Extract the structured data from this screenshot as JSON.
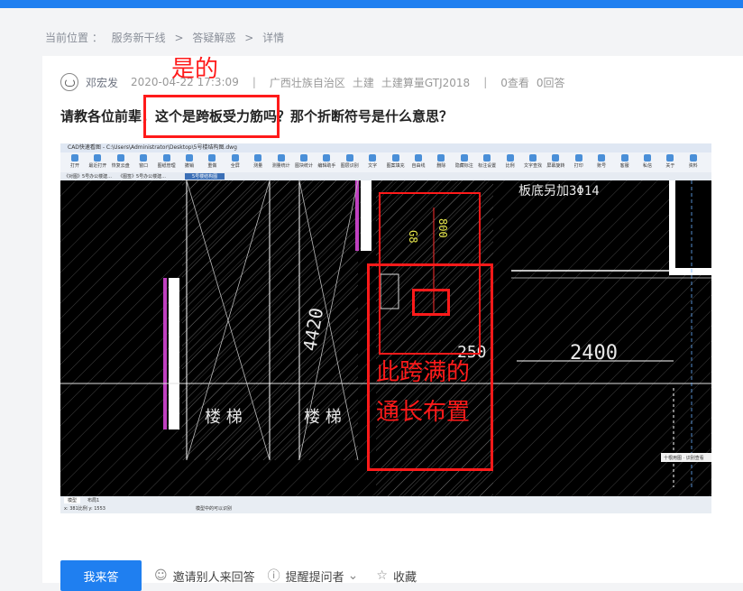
{
  "breadcrumb": {
    "label": "当前位置 ：",
    "items": [
      "服务新干线",
      ">",
      "答疑解惑",
      ">",
      "详情"
    ]
  },
  "post": {
    "author": "邓宏发",
    "date": "2020-04-22 17:3",
    "time_tail": ":09",
    "region": "广西壮族自治区",
    "major": "土建",
    "software": "土建算量GTJ2018",
    "views": "0查看",
    "answers": "0回答",
    "question": "请教各位前辈，这个是跨板受力筋吗？那个折断符号是什么意思？"
  },
  "annotations": {
    "yes": "是的",
    "note_line1": "此跨满的",
    "note_line2": "通长布置"
  },
  "cad": {
    "title": "CAD快速看图 - C:\\Users\\Administrator\\Desktop\\5号楼结构图.dwg",
    "toolbar": [
      "打开",
      "最近打开",
      "恢复云盘",
      "窗口",
      "图纸管理",
      "撤销",
      "重做",
      "全屏",
      "测量",
      "测量统计",
      "图块统计",
      "编辑助手",
      "图层识别",
      "文字",
      "图案填充",
      "自由线",
      "删除",
      "隐藏标注",
      "标注设置",
      "比例",
      "文字查找",
      "屏幕旋转",
      "打印",
      "账号",
      "客服",
      "私信",
      "关于",
      "资料"
    ],
    "tabs": [
      "《对图》5号办公楼建...",
      "《图签》5号办公楼建...",
      "5号楼结构图"
    ],
    "texts": {
      "plan_note": "板底另加3Φ14",
      "dim_800": "800",
      "dim_g8": "G8",
      "dim_4420": "4420",
      "dim_250": "250",
      "dim_2400": "2400",
      "stair_left": "楼 梯",
      "stair_right": "楼 梯"
    },
    "status": {
      "model_tab": "模型",
      "layout_tab": "布局1",
      "coords": "x: 381比例 y: 1553",
      "hint": "模型中的可以识别",
      "float": "十根用图 · 识别查看"
    }
  },
  "actions": {
    "answer": "我来答",
    "invite": "邀请别人来回答",
    "remind": "提醒提问者",
    "collect": "收藏"
  },
  "colors": {
    "accent": "#1f7ff0",
    "annotation": "#ff1a1a",
    "cad_bg": "#000000"
  }
}
